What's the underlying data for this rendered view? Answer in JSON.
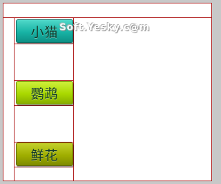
{
  "menu": {
    "items": [
      {
        "label": "小猫"
      },
      {
        "label": "鹦鹉"
      },
      {
        "label": "鲜花"
      }
    ]
  },
  "watermark": {
    "text": "Soft.Yesky.c@m"
  },
  "colors": {
    "grid_line": "#b22222",
    "item_1": "#17b3a5",
    "item_2": "#a9d800",
    "item_3": "#9fae00"
  }
}
